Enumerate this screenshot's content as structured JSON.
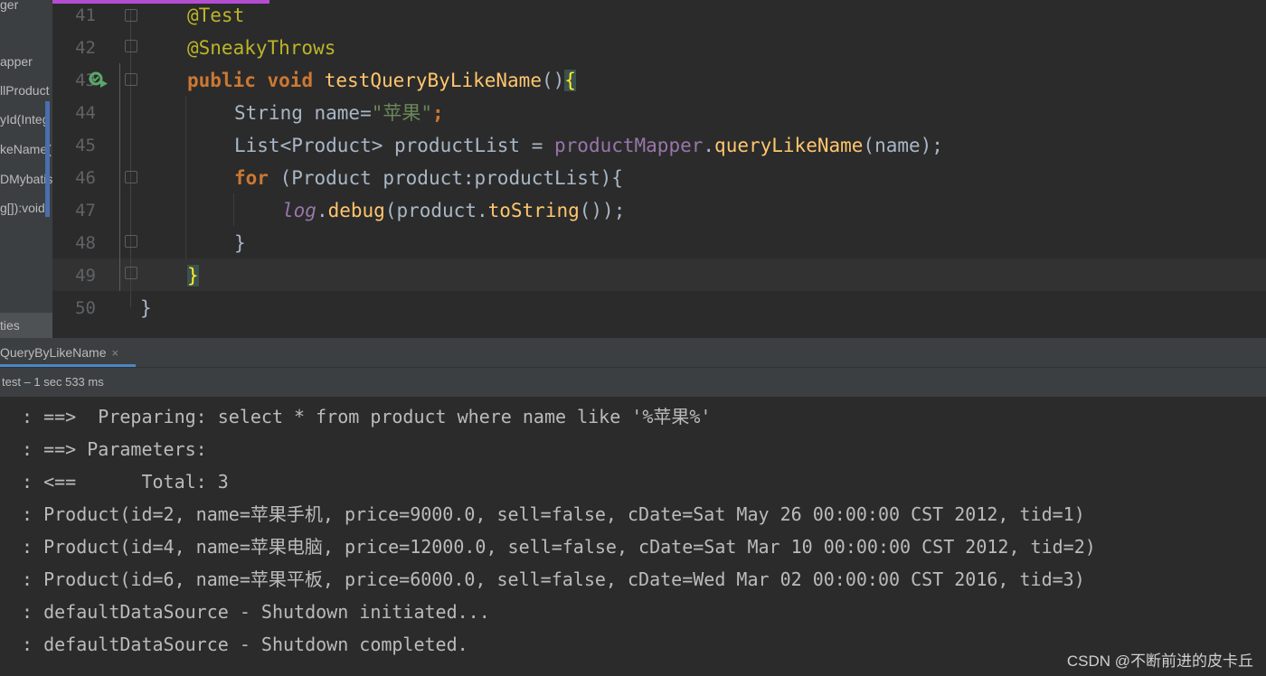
{
  "sidebar": {
    "items": [
      "ger",
      "apper",
      "llProduct",
      "yId(Integ",
      "keName(",
      "DMybatis",
      "g[]):void"
    ],
    "bottom_label": "ties"
  },
  "editor": {
    "line_numbers": [
      "41",
      "42",
      "43",
      "44",
      "45",
      "46",
      "47",
      "48",
      "49",
      "50"
    ],
    "code": {
      "l41_annotation": "@Test",
      "l42_annotation": "@SneakyThrows",
      "l43_kw1": "public",
      "l43_kw2": "void",
      "l43_method": "testQueryByLikeName",
      "l43_parens": "()",
      "l43_brace": "{",
      "l44_type": "String",
      "l44_var": " name=",
      "l44_string": "\"苹果\"",
      "l44_end": ";",
      "l45_text": "List<Product> productList = ",
      "l45_field": "productMapper",
      "l45_dot": ".",
      "l45_call": "queryLikeName",
      "l45_end": "(name);",
      "l46_kw": "for",
      "l46_text": " (Product product:productList){",
      "l47_log": "log",
      "l47_dot": ".",
      "l47_debug": "debug",
      "l47_mid": "(product.",
      "l47_tostring": "toString",
      "l47_end": "());",
      "l48_text": "}",
      "l49_brace": "}",
      "l50_text": "}"
    }
  },
  "run_panel": {
    "tab_label": "QueryByLikeName",
    "close_icon": "×",
    "status": "test – 1 sec 533 ms"
  },
  "console": {
    "lines": [
      ": ==>  Preparing: select * from product where name like '%苹果%'",
      ": ==> Parameters: ",
      ": <==      Total: 3",
      ": Product(id=2, name=苹果手机, price=9000.0, sell=false, cDate=Sat May 26 00:00:00 CST 2012, tid=1)",
      ": Product(id=4, name=苹果电脑, price=12000.0, sell=false, cDate=Sat Mar 10 00:00:00 CST 2012, tid=2)",
      ": Product(id=6, name=苹果平板, price=6000.0, sell=false, cDate=Wed Mar 02 00:00:00 CST 2016, tid=3)",
      ": defaultDataSource - Shutdown initiated...",
      ": defaultDataSource - Shutdown completed."
    ]
  },
  "watermark": "CSDN @不断前进的皮卡丘"
}
